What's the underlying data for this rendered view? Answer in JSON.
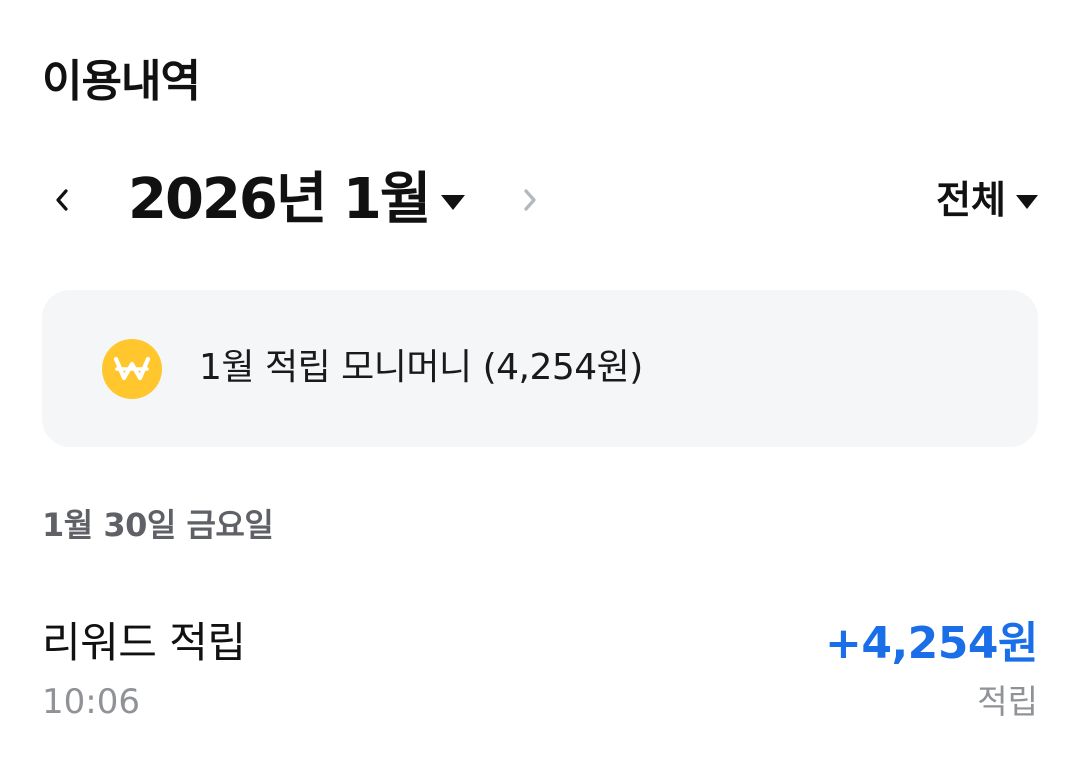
{
  "header": {
    "title": "이용내역"
  },
  "month_nav": {
    "month_label": "2026년 1월",
    "prev_icon": "chevron-left-icon",
    "next_icon": "chevron-right-icon",
    "next_enabled": false
  },
  "filter": {
    "selected": "전체"
  },
  "summary": {
    "icon": "won-coin-icon",
    "icon_color": "#ffc62e",
    "text": "1월 적립 모니머니 (4,254원)"
  },
  "history": {
    "groups": [
      {
        "date": "1월 30일 금요일",
        "items": [
          {
            "title": "리워드 적립",
            "time": "10:06",
            "amount": "+4,254원",
            "status": "적립"
          }
        ]
      }
    ]
  },
  "colors": {
    "accent_blue": "#1a6fe8",
    "card_bg": "#f5f6f8",
    "secondary_text": "#8f9297",
    "date_text": "#5f6167"
  }
}
